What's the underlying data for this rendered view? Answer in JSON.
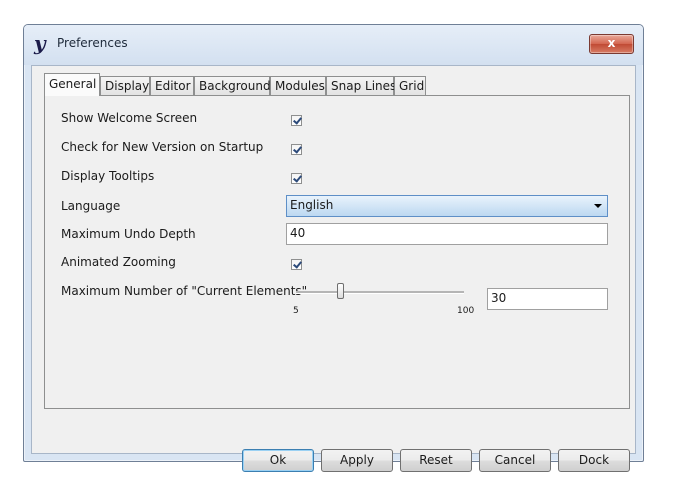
{
  "window": {
    "title": "Preferences",
    "close_label": "x"
  },
  "tabs": [
    {
      "label": "General"
    },
    {
      "label": "Display"
    },
    {
      "label": "Editor"
    },
    {
      "label": "Background"
    },
    {
      "label": "Modules"
    },
    {
      "label": "Snap Lines"
    },
    {
      "label": "Grid"
    }
  ],
  "active_tab": "General",
  "general": {
    "show_welcome": {
      "label": "Show Welcome Screen",
      "checked": true
    },
    "check_version": {
      "label": "Check for New Version on Startup",
      "checked": true
    },
    "tooltips": {
      "label": "Display Tooltips",
      "checked": true
    },
    "language": {
      "label": "Language",
      "value": "English"
    },
    "undo_depth": {
      "label": "Maximum Undo Depth",
      "value": "40"
    },
    "zooming": {
      "label": "Animated Zooming",
      "checked": true
    },
    "current_elements": {
      "label": "Maximum Number of \"Current Elements\"",
      "min_label": "5",
      "max_label": "100",
      "value": "30"
    }
  },
  "buttons": {
    "ok": "Ok",
    "apply": "Apply",
    "reset": "Reset",
    "cancel": "Cancel",
    "dock": "Dock"
  },
  "colors": {
    "accent": "#5e8fc7",
    "close": "#c04a34"
  }
}
